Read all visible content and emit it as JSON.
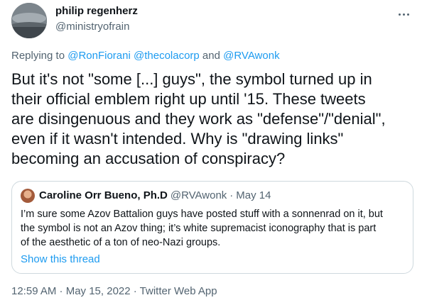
{
  "author": {
    "display_name": "philip regenherz",
    "handle": "@ministryofrain",
    "avatar_icon": "avatar-icon"
  },
  "more_icon": "more-icon",
  "reply": {
    "prefix": "Replying to ",
    "mentions": [
      "@RonFiorani",
      "@thecolacorp",
      "@RVAwonk"
    ],
    "separator_space": " ",
    "and_text": " and "
  },
  "tweet": {
    "text": "But it's not \"some [...] guys\", the symbol turned up in\ntheir official emblem right up until '15. These tweets\nare disingenuous and they work as \"defense\"/\"denial\",\neven if it wasn't intended. Why is \"drawing links\"\nbecoming an accusation of conspiracy?"
  },
  "quote": {
    "display_name": "Caroline Orr Bueno, Ph.D",
    "handle": "@RVAwonk",
    "separator": "·",
    "date": "May 14",
    "body": "I’m sure some Azov Battalion guys have posted stuff with a sonnenrad on it, but\nthe symbol is not an Azov thing; it’s white supremacist iconography that is part\nof the aesthetic of a ton of neo-Nazi groups.",
    "show_thread": "Show this thread"
  },
  "timestamp": "12:59 AM · May 15, 2022 · Twitter Web App",
  "colors": {
    "link": "#1d9bf0",
    "secondary_text": "#536471",
    "primary_text": "#0f1419",
    "border": "#cfd9de"
  }
}
